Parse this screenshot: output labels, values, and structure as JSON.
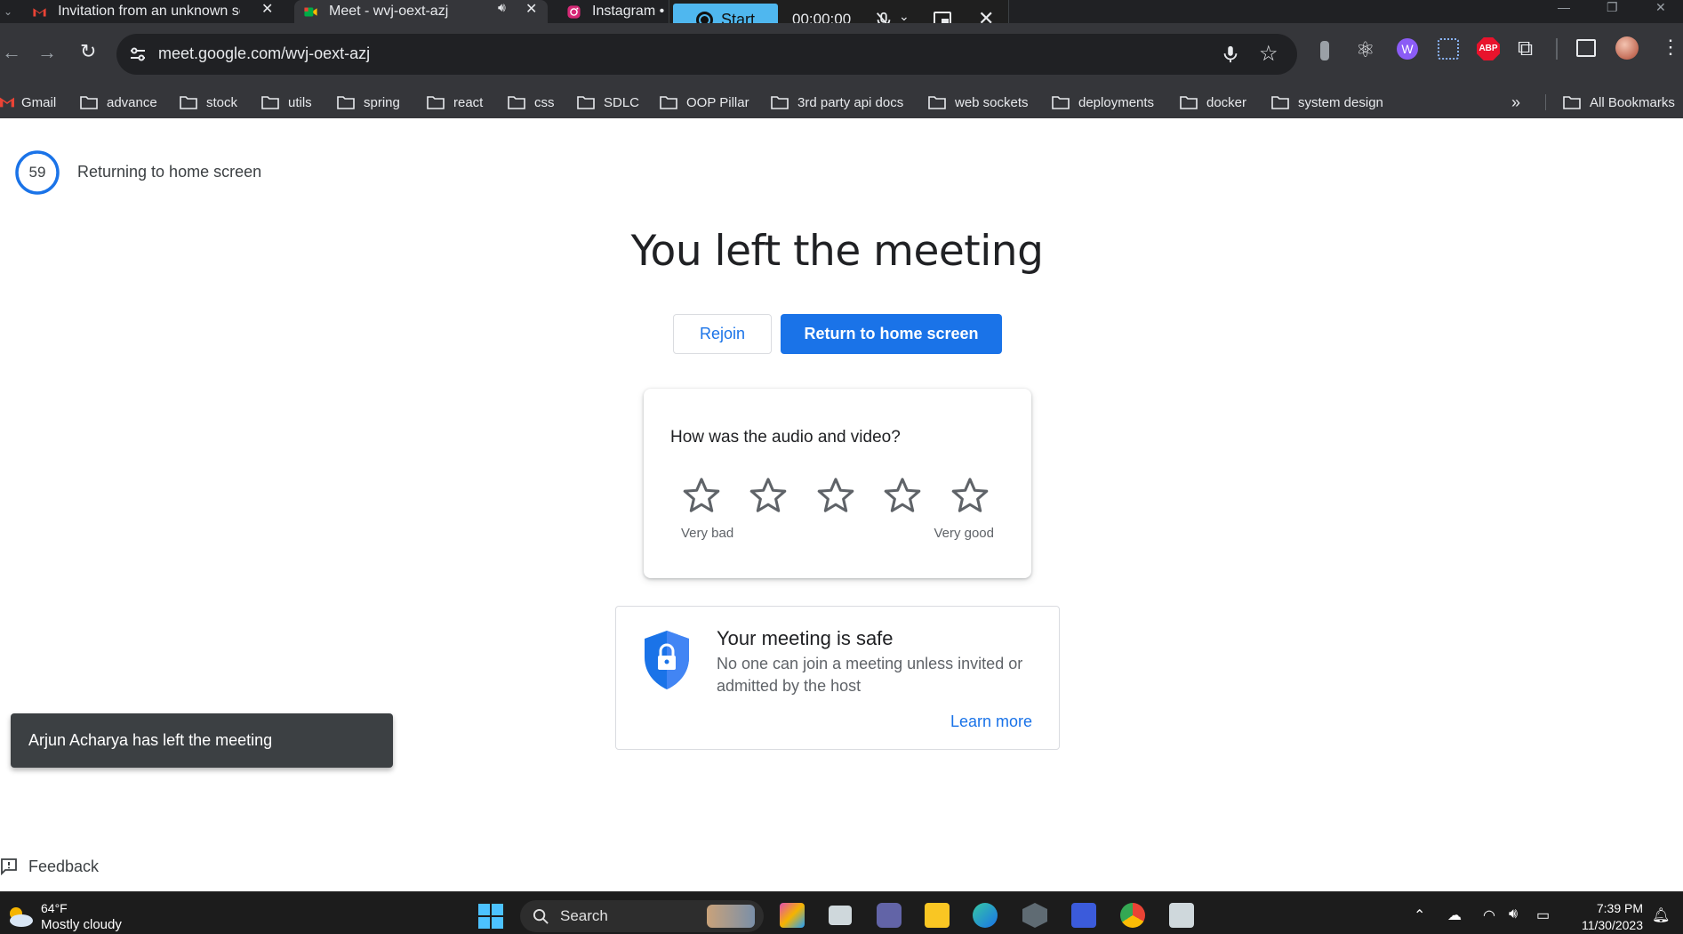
{
  "browser": {
    "tabs": [
      {
        "title": "Invitation from an unknown ser",
        "close": "✕"
      },
      {
        "title": "Meet - wvj-oext-azj",
        "close": "✕"
      },
      {
        "title": "Instagram • "
      }
    ],
    "url": "meet.google.com/wvj-oext-azj",
    "bookmarks": [
      "Gmail",
      "advance",
      "stock",
      "utils",
      "spring",
      "react",
      "css",
      "SDLC",
      "OOP Pillar",
      "3rd party api docs",
      "web sockets",
      "deployments",
      "docker",
      "system design"
    ],
    "all_bookmarks": "All Bookmarks",
    "overflow": "»",
    "extensions": {
      "abp": "ABP"
    }
  },
  "recorder": {
    "start_label": "Start",
    "timer": "00:00:00"
  },
  "meet": {
    "countdown": "59",
    "returning_text": "Returning to home screen",
    "headline": "You left the meeting",
    "rejoin_label": "Rejoin",
    "home_label": "Return to home screen",
    "rating": {
      "question": "How was the audio and video?",
      "stars": 5,
      "selected": 0,
      "low_label": "Very bad",
      "high_label": "Very good"
    },
    "safe": {
      "title": "Your meeting is safe",
      "body": "No one can join a meeting unless invited or admitted by the host",
      "learn_more": "Learn more"
    },
    "toast": "Arjun Acharya has left the meeting",
    "feedback": "Feedback"
  },
  "taskbar": {
    "weather_temp": "64°F",
    "weather_desc": "Mostly cloudy",
    "search_label": "Search",
    "time": "7:39 PM",
    "date": "11/30/2023"
  },
  "colors": {
    "accent": "#1a73e8",
    "chrome_dark": "#202124",
    "chrome_toolbar": "#35363a",
    "recorder_blue": "#4fb7ef"
  }
}
